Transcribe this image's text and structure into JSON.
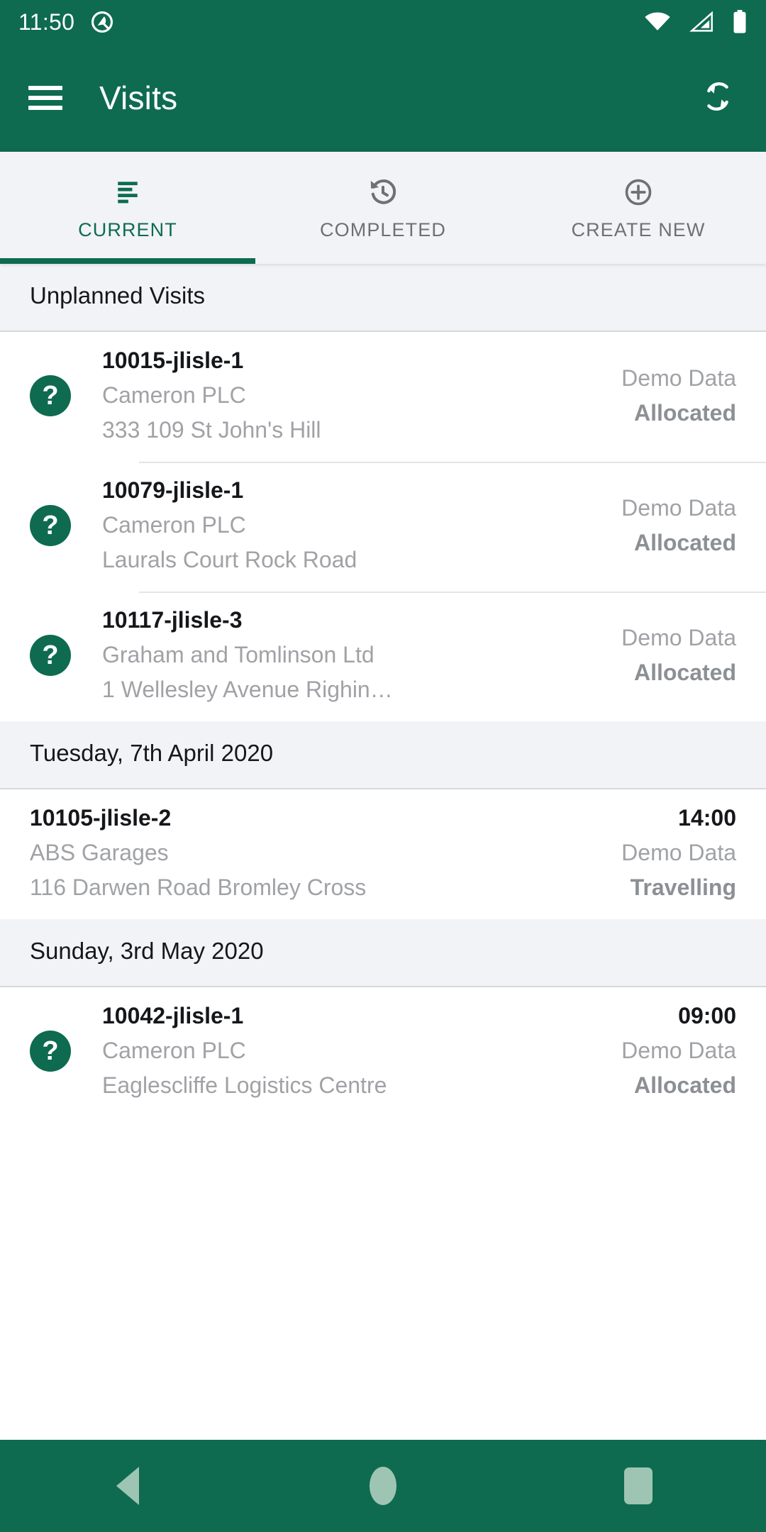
{
  "theme": {
    "primary": "#0E6B4F",
    "section_bg": "#F2F3F7",
    "muted_text": "#A0A2A6",
    "status_text": "#8C9094",
    "nav_icon": "#9EC5B4"
  },
  "status_bar": {
    "time": "11:50",
    "left_icon": "android-q-icon",
    "icons": [
      "wifi-icon",
      "cellular-signal-icon",
      "battery-icon"
    ]
  },
  "app_bar": {
    "menu_icon": "hamburger-menu-icon",
    "title": "Visits",
    "action_icon": "sync-refresh-icon"
  },
  "tabs": [
    {
      "label": "CURRENT",
      "icon": "list-lines-icon",
      "active": true
    },
    {
      "label": "COMPLETED",
      "icon": "history-clock-icon",
      "active": false
    },
    {
      "label": "CREATE NEW",
      "icon": "plus-circle-icon",
      "active": false
    }
  ],
  "sections": [
    {
      "header": "Unplanned Visits",
      "items": [
        {
          "status_icon": "question-mark-icon",
          "reference": "10015-jlisle-1",
          "customer": "Cameron PLC",
          "address": "333 109 St John's Hill",
          "time": "",
          "source": "Demo Data",
          "status": "Allocated"
        },
        {
          "status_icon": "question-mark-icon",
          "reference": "10079-jlisle-1",
          "customer": "Cameron PLC",
          "address": "Laurals Court Rock Road",
          "time": "",
          "source": "Demo Data",
          "status": "Allocated"
        },
        {
          "status_icon": "question-mark-icon",
          "reference": "10117-jlisle-3",
          "customer": "Graham and Tomlinson Ltd",
          "address": "1 Wellesley Avenue Righin…",
          "time": "",
          "source": "Demo Data",
          "status": "Allocated"
        }
      ]
    },
    {
      "header": "Tuesday, 7th April 2020",
      "items": [
        {
          "status_icon": "",
          "reference": "10105-jlisle-2",
          "customer": "ABS Garages",
          "address": "116 Darwen Road Bromley Cross",
          "time": "14:00",
          "source": "Demo Data",
          "status": "Travelling"
        }
      ]
    },
    {
      "header": "Sunday, 3rd May 2020",
      "items": [
        {
          "status_icon": "question-mark-icon",
          "reference": "10042-jlisle-1",
          "customer": "Cameron PLC",
          "address": "Eaglescliffe Logistics Centre",
          "time": "09:00",
          "source": "Demo Data",
          "status": "Allocated"
        }
      ]
    }
  ],
  "nav_bar": {
    "back": "back-triangle-icon",
    "home": "home-circle-icon",
    "recents": "recents-square-icon"
  },
  "glyphs": {
    "question": "?"
  }
}
